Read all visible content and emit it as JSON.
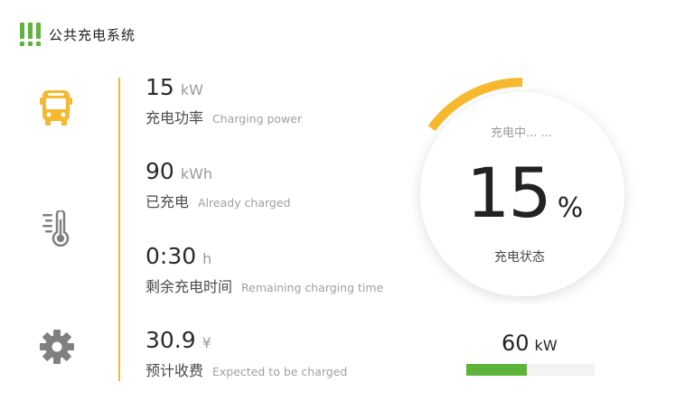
{
  "app": {
    "title": "公共充电系统"
  },
  "colors": {
    "accent_orange": "#f5b82e",
    "accent_green": "#5db43a"
  },
  "icons": {
    "bus": "bus-icon",
    "thermometer": "thermometer-icon",
    "settings": "gear-icon"
  },
  "metrics": [
    {
      "value": "15",
      "unit": "kW",
      "label_cn": "充电功率",
      "label_en": "Charging power"
    },
    {
      "value": "90",
      "unit": "kWh",
      "label_cn": "已充电",
      "label_en": "Already charged"
    },
    {
      "value": "0:30",
      "unit": "h",
      "label_cn": "剩余充电时间",
      "label_en": "Remaining charging time"
    },
    {
      "value": "30.9",
      "unit": "¥",
      "label_cn": "预计收费",
      "label_en": "Expected to be charged"
    }
  ],
  "gauge": {
    "status": "充电中... ...",
    "percent": "15",
    "percent_sign": "%",
    "label": "充电状态",
    "fraction": 0.15
  },
  "power": {
    "value": "60",
    "unit": "kW",
    "fraction": 0.47
  }
}
